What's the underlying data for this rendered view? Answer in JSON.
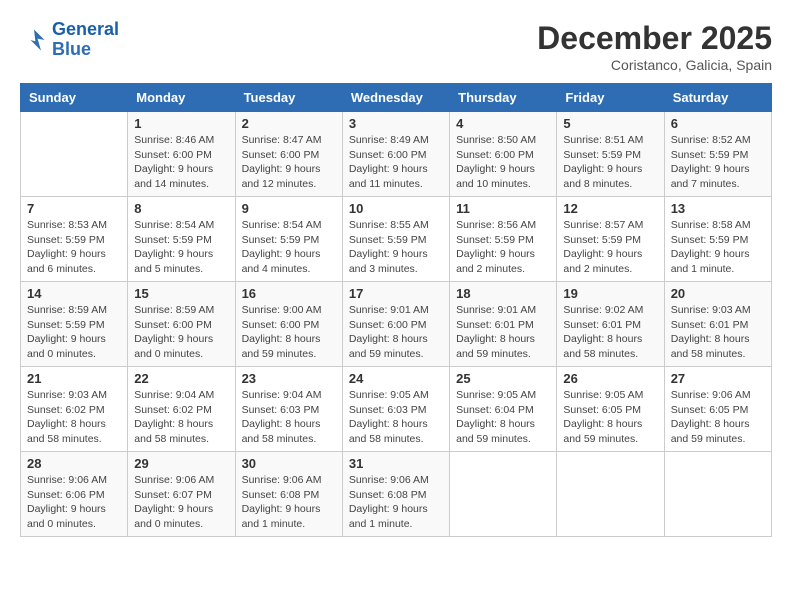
{
  "header": {
    "logo_line1": "General",
    "logo_line2": "Blue",
    "month": "December 2025",
    "location": "Coristanco, Galicia, Spain"
  },
  "weekdays": [
    "Sunday",
    "Monday",
    "Tuesday",
    "Wednesday",
    "Thursday",
    "Friday",
    "Saturday"
  ],
  "weeks": [
    [
      {
        "day": "",
        "info": ""
      },
      {
        "day": "1",
        "info": "Sunrise: 8:46 AM\nSunset: 6:00 PM\nDaylight: 9 hours\nand 14 minutes."
      },
      {
        "day": "2",
        "info": "Sunrise: 8:47 AM\nSunset: 6:00 PM\nDaylight: 9 hours\nand 12 minutes."
      },
      {
        "day": "3",
        "info": "Sunrise: 8:49 AM\nSunset: 6:00 PM\nDaylight: 9 hours\nand 11 minutes."
      },
      {
        "day": "4",
        "info": "Sunrise: 8:50 AM\nSunset: 6:00 PM\nDaylight: 9 hours\nand 10 minutes."
      },
      {
        "day": "5",
        "info": "Sunrise: 8:51 AM\nSunset: 5:59 PM\nDaylight: 9 hours\nand 8 minutes."
      },
      {
        "day": "6",
        "info": "Sunrise: 8:52 AM\nSunset: 5:59 PM\nDaylight: 9 hours\nand 7 minutes."
      }
    ],
    [
      {
        "day": "7",
        "info": "Sunrise: 8:53 AM\nSunset: 5:59 PM\nDaylight: 9 hours\nand 6 minutes."
      },
      {
        "day": "8",
        "info": "Sunrise: 8:54 AM\nSunset: 5:59 PM\nDaylight: 9 hours\nand 5 minutes."
      },
      {
        "day": "9",
        "info": "Sunrise: 8:54 AM\nSunset: 5:59 PM\nDaylight: 9 hours\nand 4 minutes."
      },
      {
        "day": "10",
        "info": "Sunrise: 8:55 AM\nSunset: 5:59 PM\nDaylight: 9 hours\nand 3 minutes."
      },
      {
        "day": "11",
        "info": "Sunrise: 8:56 AM\nSunset: 5:59 PM\nDaylight: 9 hours\nand 2 minutes."
      },
      {
        "day": "12",
        "info": "Sunrise: 8:57 AM\nSunset: 5:59 PM\nDaylight: 9 hours\nand 2 minutes."
      },
      {
        "day": "13",
        "info": "Sunrise: 8:58 AM\nSunset: 5:59 PM\nDaylight: 9 hours\nand 1 minute."
      }
    ],
    [
      {
        "day": "14",
        "info": "Sunrise: 8:59 AM\nSunset: 5:59 PM\nDaylight: 9 hours\nand 0 minutes."
      },
      {
        "day": "15",
        "info": "Sunrise: 8:59 AM\nSunset: 6:00 PM\nDaylight: 9 hours\nand 0 minutes."
      },
      {
        "day": "16",
        "info": "Sunrise: 9:00 AM\nSunset: 6:00 PM\nDaylight: 8 hours\nand 59 minutes."
      },
      {
        "day": "17",
        "info": "Sunrise: 9:01 AM\nSunset: 6:00 PM\nDaylight: 8 hours\nand 59 minutes."
      },
      {
        "day": "18",
        "info": "Sunrise: 9:01 AM\nSunset: 6:01 PM\nDaylight: 8 hours\nand 59 minutes."
      },
      {
        "day": "19",
        "info": "Sunrise: 9:02 AM\nSunset: 6:01 PM\nDaylight: 8 hours\nand 58 minutes."
      },
      {
        "day": "20",
        "info": "Sunrise: 9:03 AM\nSunset: 6:01 PM\nDaylight: 8 hours\nand 58 minutes."
      }
    ],
    [
      {
        "day": "21",
        "info": "Sunrise: 9:03 AM\nSunset: 6:02 PM\nDaylight: 8 hours\nand 58 minutes."
      },
      {
        "day": "22",
        "info": "Sunrise: 9:04 AM\nSunset: 6:02 PM\nDaylight: 8 hours\nand 58 minutes."
      },
      {
        "day": "23",
        "info": "Sunrise: 9:04 AM\nSunset: 6:03 PM\nDaylight: 8 hours\nand 58 minutes."
      },
      {
        "day": "24",
        "info": "Sunrise: 9:05 AM\nSunset: 6:03 PM\nDaylight: 8 hours\nand 58 minutes."
      },
      {
        "day": "25",
        "info": "Sunrise: 9:05 AM\nSunset: 6:04 PM\nDaylight: 8 hours\nand 59 minutes."
      },
      {
        "day": "26",
        "info": "Sunrise: 9:05 AM\nSunset: 6:05 PM\nDaylight: 8 hours\nand 59 minutes."
      },
      {
        "day": "27",
        "info": "Sunrise: 9:06 AM\nSunset: 6:05 PM\nDaylight: 8 hours\nand 59 minutes."
      }
    ],
    [
      {
        "day": "28",
        "info": "Sunrise: 9:06 AM\nSunset: 6:06 PM\nDaylight: 9 hours\nand 0 minutes."
      },
      {
        "day": "29",
        "info": "Sunrise: 9:06 AM\nSunset: 6:07 PM\nDaylight: 9 hours\nand 0 minutes."
      },
      {
        "day": "30",
        "info": "Sunrise: 9:06 AM\nSunset: 6:08 PM\nDaylight: 9 hours\nand 1 minute."
      },
      {
        "day": "31",
        "info": "Sunrise: 9:06 AM\nSunset: 6:08 PM\nDaylight: 9 hours\nand 1 minute."
      },
      {
        "day": "",
        "info": ""
      },
      {
        "day": "",
        "info": ""
      },
      {
        "day": "",
        "info": ""
      }
    ]
  ]
}
